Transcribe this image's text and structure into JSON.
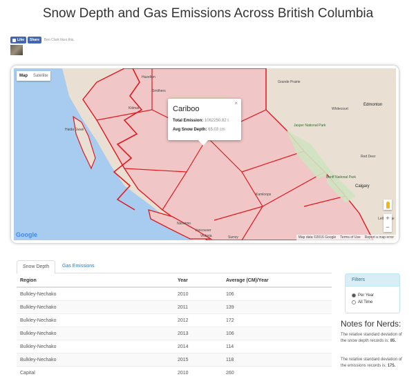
{
  "page": {
    "title": "Snow Depth and Gas Emissions Across British Columbia"
  },
  "facebook": {
    "like_label": "Like",
    "share_label": "Share",
    "social_text": "Ben Clark likes this."
  },
  "map": {
    "type_controls": [
      "Map",
      "Satellite"
    ],
    "places": [
      {
        "label": "Grande Prairie",
        "cls": ""
      },
      {
        "label": "Whitecourt",
        "cls": ""
      },
      {
        "label": "Edmonton",
        "cls": "big"
      },
      {
        "label": "Jasper National Park",
        "cls": "park"
      },
      {
        "label": "Red Deer",
        "cls": ""
      },
      {
        "label": "Banff National Park",
        "cls": "park"
      },
      {
        "label": "Calgary",
        "cls": "big"
      },
      {
        "label": "Kamloops",
        "cls": ""
      },
      {
        "label": "Haida Gwaii",
        "cls": ""
      },
      {
        "label": "Hazelton",
        "cls": ""
      },
      {
        "label": "Smithers",
        "cls": ""
      },
      {
        "label": "Kitimat",
        "cls": ""
      },
      {
        "label": "Vancouver",
        "cls": ""
      },
      {
        "label": "Surrey",
        "cls": ""
      },
      {
        "label": "Lethbridge",
        "cls": ""
      },
      {
        "label": "Nanaimo",
        "cls": ""
      },
      {
        "label": "Victoria",
        "cls": ""
      }
    ],
    "info_window": {
      "title": "Cariboo",
      "total_emission_label": "Total Emission:",
      "total_emission_value": "1062250.82 t",
      "avg_snow_label": "Avg Snow Depth:",
      "avg_snow_value": "65.03 cm",
      "close_glyph": "×"
    },
    "zoom_in": "+",
    "zoom_out": "−",
    "google_logo": "Google",
    "attribution": [
      "Map data ©2016 Google",
      "Terms of Use",
      "Report a map error"
    ],
    "colors": {
      "water": "#a7ccef",
      "land": "#e9dfd3",
      "region_fill": "#f0c6c6",
      "region_border": "#e0191f"
    }
  },
  "tabs": [
    {
      "label": "Snow Depth",
      "active": true
    },
    {
      "label": "Gas Emissions",
      "active": false
    }
  ],
  "table": {
    "headers": [
      "Region",
      "Year",
      "Average (CM)/Year"
    ],
    "rows": [
      [
        "Bulkley-Nechako",
        "2010",
        "106"
      ],
      [
        "Bulkley-Nechako",
        "2011",
        "139"
      ],
      [
        "Bulkley-Nechako",
        "2012",
        "172"
      ],
      [
        "Bulkley-Nechako",
        "2013",
        "106"
      ],
      [
        "Bulkley-Nechako",
        "2014",
        "114"
      ],
      [
        "Bulkley-Nechako",
        "2015",
        "118"
      ],
      [
        "Capital",
        "2010",
        "260"
      ]
    ]
  },
  "filters": {
    "heading": "Filters",
    "options": [
      {
        "label": "Per Year",
        "selected": true
      },
      {
        "label": "All Time",
        "selected": false
      }
    ]
  },
  "notes": {
    "heading": "Notes for Nerds:",
    "p1_text": "The relative standard deviation of the snow depth records is: ",
    "p1_value": "85.",
    "p2_text": "The relative standard deviation of the emissions records is: ",
    "p2_value": "175."
  }
}
